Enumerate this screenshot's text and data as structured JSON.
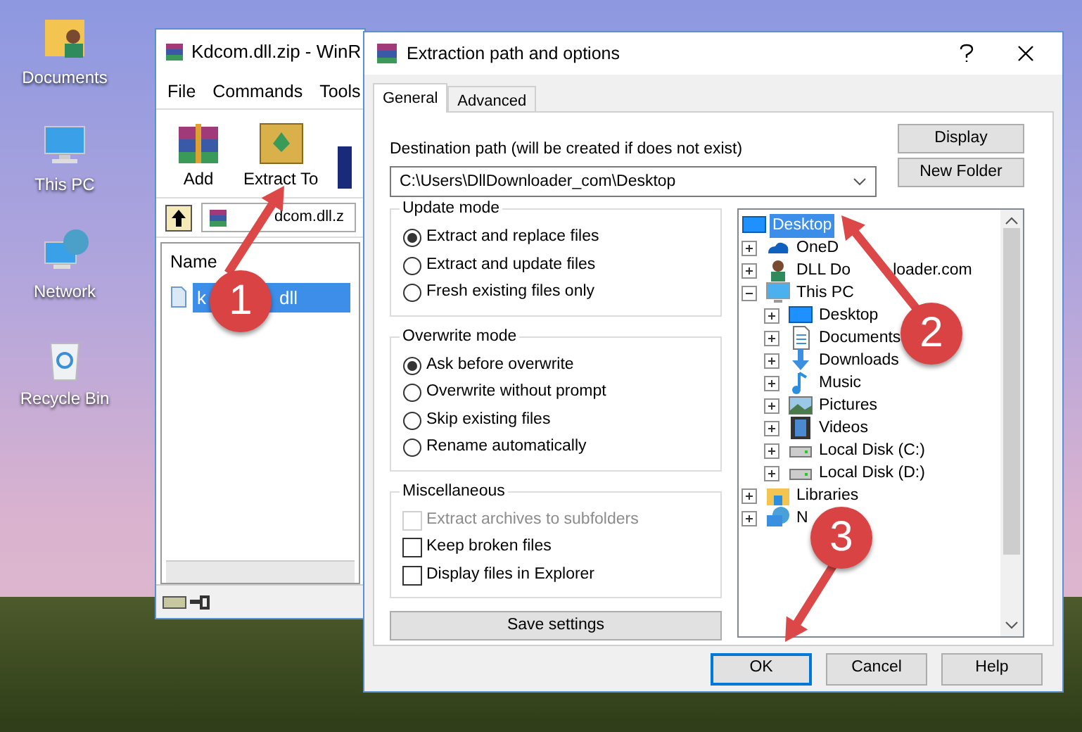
{
  "desktop_icons": [
    {
      "label": "Documents"
    },
    {
      "label": "This PC"
    },
    {
      "label": "Network"
    },
    {
      "label": "Recycle Bin"
    }
  ],
  "archiver_window": {
    "title": "Kdcom.dll.zip - WinR",
    "menu": [
      "File",
      "Commands",
      "Tools"
    ],
    "toolbar": [
      {
        "label": "Add"
      },
      {
        "label": "Extract To"
      }
    ],
    "path": "dcom.dll.z",
    "column": "Name",
    "files": [
      {
        "name": "k",
        "name_tail": "dll",
        "selected": true
      }
    ]
  },
  "dialog": {
    "title": "Extraction path and options",
    "tabs": [
      {
        "label": "General",
        "selected": true
      },
      {
        "label": "Advanced",
        "selected": false
      }
    ],
    "destination_label": "Destination path (will be created if does not exist)",
    "destination_value": "C:\\Users\\DllDownloader_com\\Desktop",
    "side_buttons": [
      "Display",
      "New Folder"
    ],
    "groups": [
      {
        "title": "Update mode",
        "options": [
          {
            "kind": "radio",
            "label": "Extract and replace files",
            "selected": true
          },
          {
            "kind": "radio",
            "label": "Extract and update files",
            "selected": false
          },
          {
            "kind": "radio",
            "label": "Fresh existing files only",
            "selected": false
          }
        ]
      },
      {
        "title": "Overwrite mode",
        "options": [
          {
            "kind": "radio",
            "label": "Ask before overwrite",
            "selected": true
          },
          {
            "kind": "radio",
            "label": "Overwrite without prompt",
            "selected": false
          },
          {
            "kind": "radio",
            "label": "Skip existing files",
            "selected": false
          },
          {
            "kind": "radio",
            "label": "Rename automatically",
            "selected": false
          }
        ]
      },
      {
        "title": "Miscellaneous",
        "options": [
          {
            "kind": "checkbox",
            "label": "Extract archives to subfolders",
            "checked": false,
            "disabled": true
          },
          {
            "kind": "checkbox",
            "label": "Keep broken files",
            "checked": false,
            "disabled": false
          },
          {
            "kind": "checkbox",
            "label": "Display files in Explorer",
            "checked": false,
            "disabled": false
          }
        ]
      }
    ],
    "save_button": "Save settings",
    "tree": [
      {
        "label": "Desktop",
        "kind": "desktop",
        "selected": true,
        "children": [
          {
            "label": "OneD",
            "kind": "cloud",
            "selected": false,
            "expanded": false
          },
          {
            "label": "DLL Do",
            "label_tail": "loader.com",
            "kind": "user",
            "selected": false,
            "expanded": false
          },
          {
            "label": "This PC",
            "kind": "pc",
            "selected": false,
            "expanded": true,
            "children": [
              {
                "label": "Desktop",
                "kind": "desktop",
                "selected": false,
                "expanded": false
              },
              {
                "label": "Documents",
                "kind": "document",
                "selected": false,
                "expanded": false
              },
              {
                "label": "Downloads",
                "kind": "download",
                "selected": false,
                "expanded": false
              },
              {
                "label": "Music",
                "kind": "music",
                "selected": false,
                "expanded": false
              },
              {
                "label": "Pictures",
                "kind": "picture",
                "selected": false,
                "expanded": false
              },
              {
                "label": "Videos",
                "kind": "video",
                "selected": false,
                "expanded": false
              },
              {
                "label": "Local Disk (C:)",
                "kind": "disk",
                "selected": false,
                "expanded": false
              },
              {
                "label": "Local Disk (D:)",
                "kind": "disk",
                "selected": false,
                "expanded": false
              }
            ]
          },
          {
            "label": "Libraries",
            "kind": "folder",
            "selected": false,
            "expanded": false
          },
          {
            "label": "N",
            "kind": "network",
            "selected": false,
            "expanded": false
          }
        ]
      }
    ],
    "buttons": [
      {
        "label": "OK",
        "default": true
      },
      {
        "label": "Cancel",
        "default": false
      },
      {
        "label": "Help",
        "default": false
      }
    ]
  },
  "annotations": [
    {
      "number": "1"
    },
    {
      "number": "2"
    },
    {
      "number": "3"
    }
  ]
}
